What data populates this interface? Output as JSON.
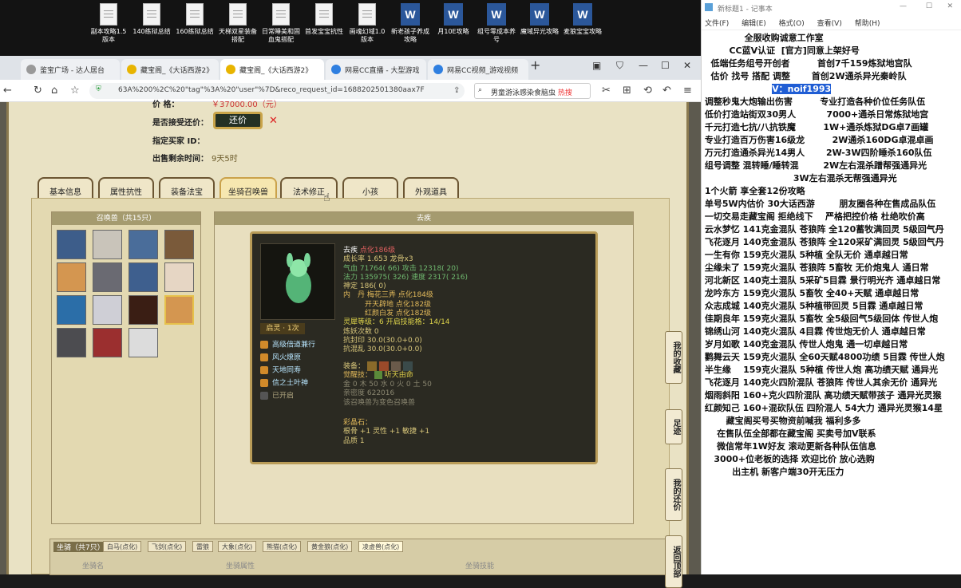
{
  "desktop": {
    "icons": [
      "副本攻略1.5版本",
      "140练狱总结",
      "160练狱总结",
      "天梯双星装备搭配",
      "日常睡美和固血鬼搭配",
      "首发宝宝抗性",
      "画魂幻域1.0版本",
      "新老孩子养成攻略",
      "月10E攻略",
      "组号零成本养号",
      "魔域异光攻略",
      "麦狼宝宝攻略"
    ]
  },
  "browser": {
    "tabs": [
      "鉴宝广场 - 达人居台",
      "藏宝阁_《大话西游2》",
      "藏宝阁_《大话西游2》",
      "网易CC直播 - 大型游戏",
      "网易CC视频_游戏视频"
    ],
    "url": "63A%200%2C%20\"tag\"%3A%20\"user\"%7D&reco_request_id=1688202501380aax7F",
    "search": "男童游泳感染食脑虫",
    "search_tag": "热搜"
  },
  "page": {
    "price_label": "价 格：",
    "price_value": "￥37000.00（元）",
    "counter_label": "是否接受还价：",
    "counter_btn": "还价",
    "buyer_label": "指定买家 ID：",
    "time_label": "出售剩余时间：",
    "time_value": "9天5时",
    "tabs": [
      "基本信息",
      "属性抗性",
      "装备法宝",
      "坐骑召唤兽",
      "法术修正",
      "小孩",
      "外观道具"
    ],
    "pet_list_title": "召唤兽（共15只）",
    "detail_title": "去疾",
    "pet": {
      "name": "去疾",
      "name_tag": "点化186级",
      "lines": [
        "成长率 1.653 龙骨x3",
        "气血 71764( 66) 攻击 12318( 20)",
        "法力 135975( 326) 速度 2317( 216)",
        "神定 186( 0)",
        "内　丹 梅花三弄 点化184级",
        "　　　开天辟地 点化182级",
        "　　　红颜白发 点化182级",
        "灵犀等级：6 开启技能格：14/14",
        "炼妖次数 0",
        "抗封印 30.0(30.0+0.0)",
        "抗混乱 30.0(30.0+0.0)"
      ],
      "equip_label": "装备：",
      "awaken_label": "觉醒技：",
      "awaken_value": "听天由命",
      "elements": "金 0 木 50 水 0 火 0 土 50",
      "intimacy": "亲密度 622016",
      "note": "该召唤兽为变色召唤兽",
      "jewel_label": "彩晶石：",
      "jewel_lines": [
        "根骨 +1 灵性 +1 敏捷 +1",
        "品质 1"
      ],
      "qiling": "启灵 · 1次",
      "skills": [
        "高级倍道兼行",
        "风火燎原",
        "天地同寿",
        "信之土叶神",
        "已开启"
      ]
    },
    "side_buttons": [
      "我的收藏",
      "足迹",
      "我的还价",
      "返回顶部"
    ],
    "mount_title": "坐骑（共7只）",
    "mount_tabs": [
      "白马(点化)",
      "飞剑(点化)",
      "雷狼",
      "大象(点化)",
      "熊猫(点化)",
      "黄金狼(点化)",
      "凌虚兽(点化)"
    ],
    "mount_cols": [
      "坐骑名",
      "坐骑属性",
      "坐骑技能"
    ]
  },
  "notepad": {
    "title": "新标题1 - 记事本",
    "menu": [
      "文件(F)",
      "编辑(E)",
      "格式(O)",
      "查看(V)",
      "帮助(H)"
    ],
    "lines": [
      "              全服收购诚意工作室",
      "         CC蓝V认证  [官方]同意上架好号",
      "   低端任务组号开创者         首创7千159炼狱地宫队",
      "   估价 找号 搭配 调整       首创2W通杀异光秦岭队",
      "                       V：noif1993",
      "",
      " 调整秒鬼大炮输出伤害         专业打造各种价位任务队伍",
      " 低价打造站街双30男人          7000+通杀日常炼狱地宫",
      " 千元打造七抗/八抗铁魔         1W+通杀炼狱DG卓7画罐",
      " 专业打造百万伤害16级龙         2W通杀160DG卓混卓画",
      " 万元打造通杀异光14男人       2W-3W四阶睡杀160队伍",
      " 组号调整 混转睡/睡转混        2W左右混杀蹭帮强通异光",
      "                              3W左右混杀无帮强通异光",
      " 1个火箭 享全套12份攻略",
      " 单号5W内估价 30大话西游        朋友圈各种在售成品队伍",
      " 一切交易走藏宝阁 拒绝线下    严格把控价格 杜绝吹价高",
      "",
      " 云水梦忆 141克金混队 苍狼阵 全120蓄牧满回灵 5级回气丹",
      " 飞花逐月 140克金混队 苍狼阵 全120采矿满回灵 5级回气丹",
      " 一生有你 159克火混队 5种植 全队无价 通卓越日常",
      " 尘缘未了 159克火混队 苍狼阵 5畜牧 无价炮鬼人 通日常",
      " 河北新区 140克土混队 5采矿5目霖 景行明光齐 通卓越日常",
      " 龙吟东方 159克火混队 5畜牧 全40+天赋 通卓越日常",
      " 众志成城 140克火混队 5种植带回灵 5目霖 通卓越日常",
      " 佳期良年 159克火混队 5畜牧 全5级回气5级回体 传世人炮",
      " 锦绣山河 140克火混队 4目霖 传世炮无价人 通卓越日常",
      " 岁月如歌 140克金混队 传世人炮鬼 通一切卓越日常",
      " 鹳舞云天 159克火混队 全60天赋4800功绩 5目霖 传世人炮",
      " 半生缘    159克火混队 5种植 传世人炮 高功绩天赋 通异光",
      " 飞花逐月 140克火四阶混队 苍狼阵 传世人其余无价 通异光",
      " 烟雨斜阳 160+克火四阶混队 高功绩天赋带孩子 通异光灵猴",
      " 红颜知己 160+混砍队伍 四阶混人 54大力 通异光灵猴14星",
      "",
      "        藏宝阁买号买物资前喊我 福利多多",
      "     在售队伍全部都在藏宝阁 买卖号加V联系",
      "     微信常年1W好友 滚动更新各种队伍信息",
      "    3000+位老板的选择 欢迎比价 放心选购",
      "          出主机 新客户端30开无压力"
    ]
  }
}
